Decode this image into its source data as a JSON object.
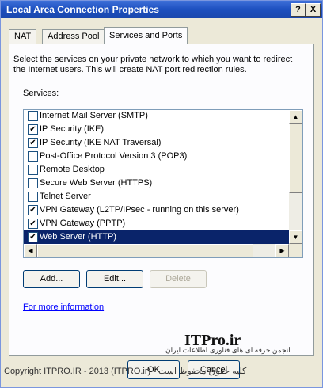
{
  "window": {
    "title": "Local Area Connection Properties",
    "help_glyph": "?",
    "close_glyph": "X"
  },
  "tabs": [
    {
      "label": "NAT"
    },
    {
      "label": "Address Pool"
    },
    {
      "label": "Services and Ports",
      "active": true
    }
  ],
  "description": "Select the services on your private network to which you want to redirect the Internet users. This will create NAT port redirection rules.",
  "services_label": "Services:",
  "services": [
    {
      "label": "Internet Mail Server (SMTP)",
      "checked": false,
      "selected": false
    },
    {
      "label": "IP Security (IKE)",
      "checked": true,
      "selected": false
    },
    {
      "label": "IP Security (IKE NAT Traversal)",
      "checked": true,
      "selected": false
    },
    {
      "label": "Post-Office Protocol Version 3 (POP3)",
      "checked": false,
      "selected": false
    },
    {
      "label": "Remote Desktop",
      "checked": false,
      "selected": false
    },
    {
      "label": "Secure Web Server (HTTPS)",
      "checked": false,
      "selected": false
    },
    {
      "label": "Telnet Server",
      "checked": false,
      "selected": false
    },
    {
      "label": "VPN Gateway (L2TP/IPsec - running on this server)",
      "checked": true,
      "selected": false
    },
    {
      "label": "VPN Gateway (PPTP)",
      "checked": true,
      "selected": false
    },
    {
      "label": "Web Server (HTTP)",
      "checked": true,
      "selected": true
    }
  ],
  "buttons": {
    "add": "Add...",
    "edit": "Edit...",
    "delete": "Delete",
    "ok": "OK",
    "cancel": "Cancel"
  },
  "more_info_link": "For more information",
  "watermark": {
    "logo": "ITPro.ir",
    "tagline": "انجمن حرفه ای های فناوری اطلاعات ایران"
  },
  "footer": {
    "copyright": "Copyright ITPRO.IR - 2013 (ITPRO.ir) - کلیه حقوق محفوظ است"
  }
}
